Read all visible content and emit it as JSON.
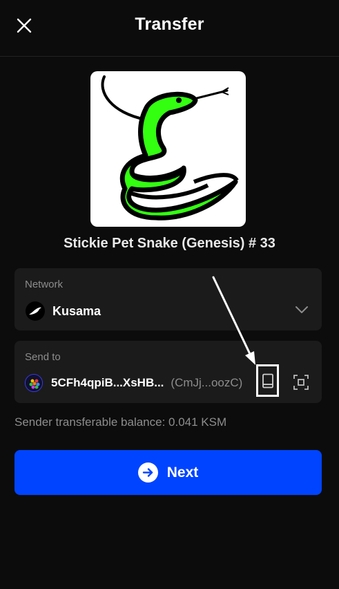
{
  "header": {
    "title": "Transfer",
    "close_icon": "close-icon"
  },
  "nft": {
    "name": "Stickie Pet Snake (Genesis) # 33",
    "image_icon": "snake-artwork"
  },
  "network": {
    "label": "Network",
    "value": "Kusama",
    "icon": "kusama-logo-icon",
    "dropdown_icon": "chevron-down-icon"
  },
  "send_to": {
    "label": "Send to",
    "address": "5CFh4qpiB...XsHB...",
    "address_short": "(CmJj...oozC)",
    "address_book_icon": "address-book-icon",
    "scan_icon": "scan-qr-icon"
  },
  "balance": {
    "text": "Sender transferable balance: 0.041 KSM"
  },
  "next_button": {
    "label": "Next",
    "icon": "arrow-right-circle-icon"
  },
  "colors": {
    "background": "#0c0c0c",
    "card": "#1b1b1b",
    "accent": "#0044ff",
    "muted_text": "#8d8d8d",
    "snake_green": "#33ff11"
  }
}
